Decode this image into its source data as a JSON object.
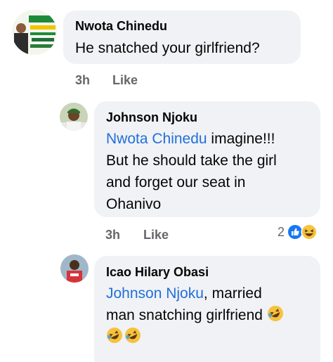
{
  "comments": [
    {
      "author": "Nwota Chinedu",
      "text": "He snatched your girlfriend?",
      "time": "3h",
      "like_label": "Like",
      "avatar_icon": "campaign-poster-avatar"
    },
    {
      "author": "Johnson Njoku",
      "mention": "Nwota Chinedu",
      "text_line1": " imagine!!!",
      "text_line2": "But he should take the girl",
      "text_line3": "and forget our seat in",
      "text_line4": "Ohanivo",
      "time": "3h",
      "like_label": "Like",
      "reaction_count": "2",
      "reaction_icons": [
        "like-reaction-icon",
        "haha-reaction-icon"
      ],
      "avatar_icon": "man-in-cap-avatar"
    },
    {
      "author": "Icao Hilary Obasi",
      "mention": "Johnson Njoku",
      "text_line1": ", married",
      "text_line2": "man snatching girlfriend",
      "emoji_icons": [
        "rofl-emoji",
        "rofl-emoji",
        "rofl-emoji"
      ],
      "avatar_icon": "man-in-red-shirt-avatar"
    }
  ],
  "colors": {
    "bubble": "#f0f2f5",
    "mention": "#216fdb",
    "meta": "#65676b",
    "like_blue": "#1877f2"
  }
}
